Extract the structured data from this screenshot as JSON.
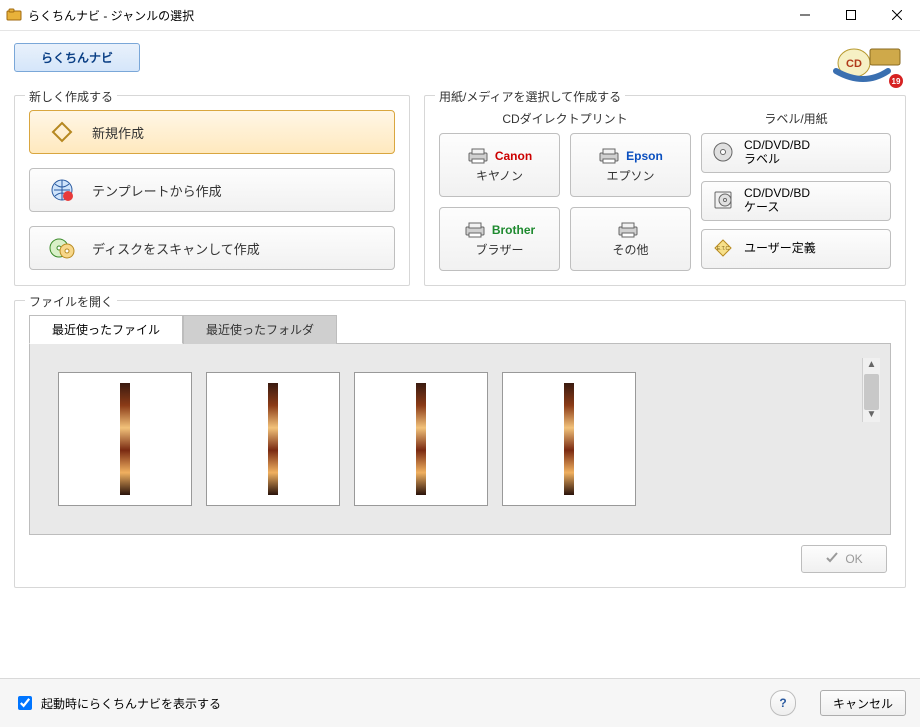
{
  "window": {
    "title": "らくちんナビ - ジャンルの選択"
  },
  "top": {
    "nav_button": "らくちんナビ",
    "brand_badge": "19"
  },
  "group_new": {
    "legend": "新しく作成する",
    "new_blank": "新規作成",
    "from_template": "テンプレートから作成",
    "from_disc_scan": "ディスクをスキャンして作成"
  },
  "group_media": {
    "legend": "用紙/メディアを選択して作成する",
    "col_direct": "CDダイレクトプリント",
    "col_label": "ラベル/用紙",
    "printers": [
      {
        "brand": "Canon",
        "brand_color": "#cc0000",
        "sub": "キヤノン"
      },
      {
        "brand": "Epson",
        "brand_color": "#0a4fbf",
        "sub": "エプソン"
      },
      {
        "brand": "Brother",
        "brand_color": "#1e8a2f",
        "sub": "ブラザー"
      },
      {
        "brand": "",
        "brand_color": "#333333",
        "sub": "その他"
      }
    ],
    "labels": [
      {
        "line1": "CD/DVD/BD",
        "line2": "ラベル"
      },
      {
        "line1": "CD/DVD/BD",
        "line2": "ケース"
      },
      {
        "line1": "ユーザー定義",
        "line2": ""
      }
    ],
    "etc_badge": "E.T.C"
  },
  "group_file": {
    "legend": "ファイルを開く",
    "tab_recent_files": "最近使ったファイル",
    "tab_recent_folders": "最近使ったフォルダ",
    "ok": "OK"
  },
  "bottom": {
    "show_on_startup": "起動時にらくちんナビを表示する",
    "cancel": "キャンセル"
  }
}
